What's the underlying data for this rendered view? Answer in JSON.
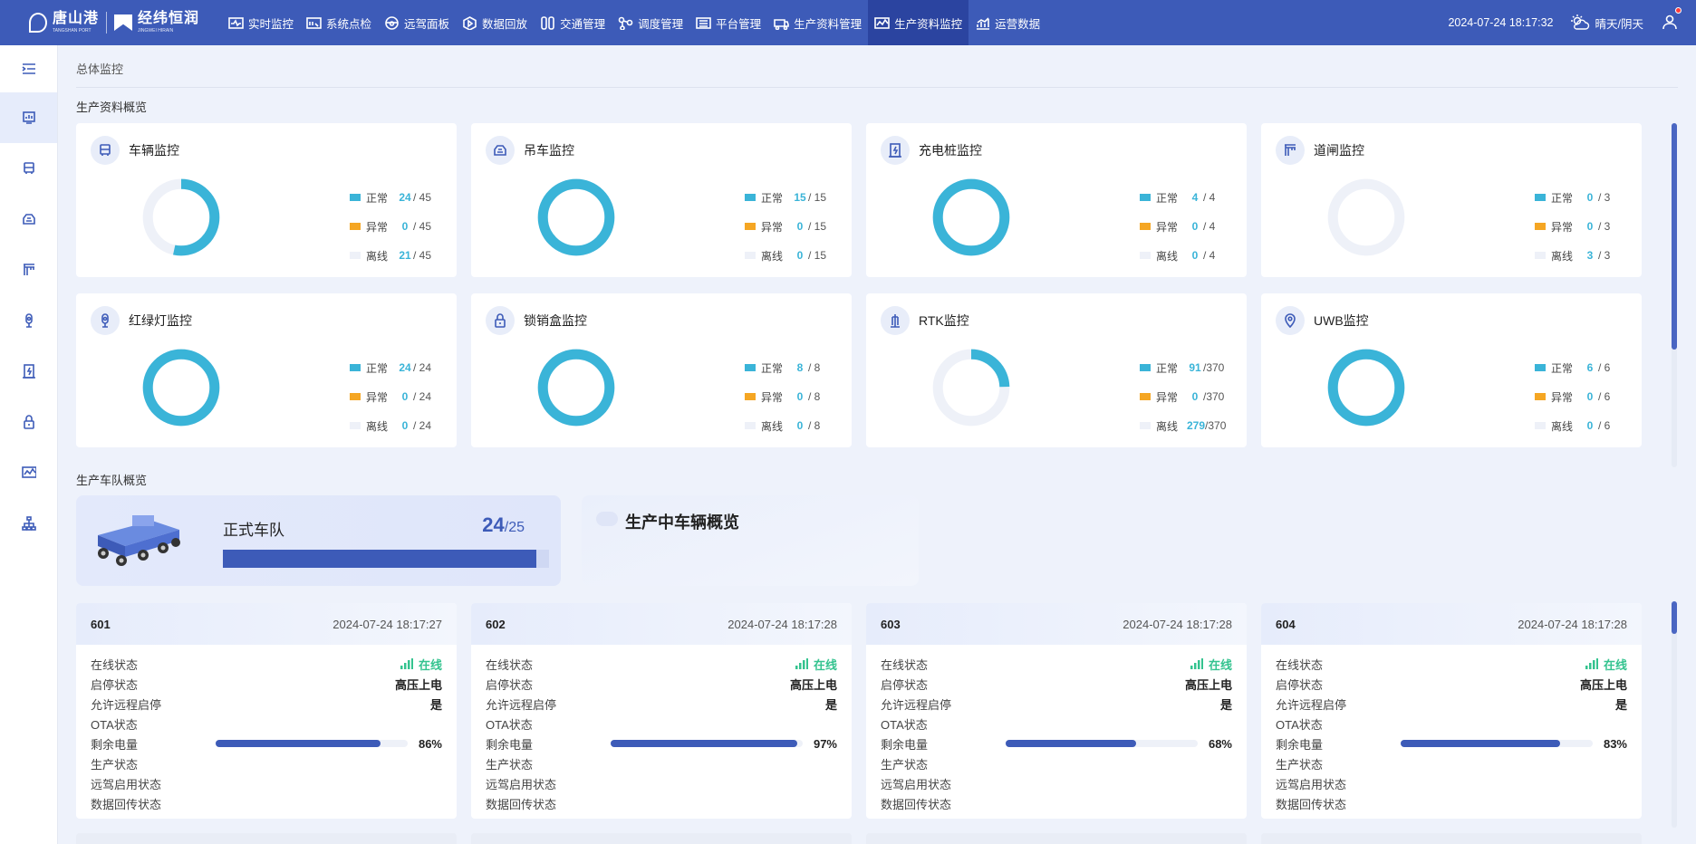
{
  "topbar": {
    "logo1": "唐山港",
    "logo1_sub": "TANGSHAN PORT",
    "logo2": "经纬恒润",
    "logo2_sub": "JINGWEI HIRAIN",
    "nav": [
      {
        "label": "实时监控",
        "icon": "pulse-icon"
      },
      {
        "label": "系统点检",
        "icon": "inspect-icon"
      },
      {
        "label": "远驾面板",
        "icon": "steering-icon"
      },
      {
        "label": "数据回放",
        "icon": "replay-icon"
      },
      {
        "label": "交通管理",
        "icon": "traffic-icon"
      },
      {
        "label": "调度管理",
        "icon": "dispatch-icon"
      },
      {
        "label": "平台管理",
        "icon": "settings-icon"
      },
      {
        "label": "生产资料管理",
        "icon": "truck-icon"
      },
      {
        "label": "生产资料监控",
        "icon": "monitor-icon"
      },
      {
        "label": "运营数据",
        "icon": "chart-icon"
      }
    ],
    "active_index": 8,
    "datetime": "2024-07-24 18:17:32",
    "weather": "晴天/阴天"
  },
  "breadcrumb": "总体监控",
  "section_resources": "生产资料概览",
  "section_fleet": "生产车队概览",
  "legend_labels": {
    "normal": "正常",
    "abnormal": "异常",
    "offline": "离线"
  },
  "monitors": [
    {
      "title": "车辆监控",
      "icon": "vehicle-icon",
      "normal": 24,
      "abnormal": 0,
      "offline": 21,
      "total": 45,
      "t_normal": "/ 45",
      "t_abnormal": "/ 45",
      "t_offline": "/ 45"
    },
    {
      "title": "吊车监控",
      "icon": "crane-icon",
      "normal": 15,
      "abnormal": 0,
      "offline": 0,
      "total": 15,
      "t_normal": "/ 15",
      "t_abnormal": "/ 15",
      "t_offline": "/ 15"
    },
    {
      "title": "充电桩监控",
      "icon": "charger-icon",
      "normal": 4,
      "abnormal": 0,
      "offline": 0,
      "total": 4,
      "t_normal": "/ 4",
      "t_abnormal": "/ 4",
      "t_offline": "/ 4"
    },
    {
      "title": "道闸监控",
      "icon": "gate-icon",
      "normal": 0,
      "abnormal": 0,
      "offline": 3,
      "total": 3,
      "t_normal": "/ 3",
      "t_abnormal": "/ 3",
      "t_offline": "/ 3"
    },
    {
      "title": "红绿灯监控",
      "icon": "traffic-light-icon",
      "normal": 24,
      "abnormal": 0,
      "offline": 0,
      "total": 24,
      "t_normal": "/ 24",
      "t_abnormal": "/ 24",
      "t_offline": "/ 24"
    },
    {
      "title": "锁销盒监控",
      "icon": "lock-icon",
      "normal": 8,
      "abnormal": 0,
      "offline": 0,
      "total": 8,
      "t_normal": "/ 8",
      "t_abnormal": "/ 8",
      "t_offline": "/ 8"
    },
    {
      "title": "RTK监控",
      "icon": "rtk-icon",
      "normal": 91,
      "abnormal": 0,
      "offline": 279,
      "total": 370,
      "t_normal": "/370",
      "t_abnormal": "/370",
      "t_offline": "/370"
    },
    {
      "title": "UWB监控",
      "icon": "location-pin-icon",
      "normal": 6,
      "abnormal": 0,
      "offline": 0,
      "total": 6,
      "t_normal": "/ 6",
      "t_abnormal": "/ 6",
      "t_offline": "/ 6"
    }
  ],
  "colors": {
    "normal": "#3ab4d8",
    "abnormal": "#f5a623",
    "offline": "#eef1f8",
    "primary": "#3d5bb8",
    "online": "#34c38f"
  },
  "fleet": {
    "title": "正式车队",
    "count": "24",
    "total": "/25",
    "ratio": 0.96
  },
  "production": {
    "title": "生产中车辆概览"
  },
  "vehicle_labels": [
    "在线状态",
    "启停状态",
    "允许远程启停",
    "OTA状态",
    "剩余电量",
    "生产状态",
    "远驾启用状态",
    "数据回传状态"
  ],
  "vehicles": [
    {
      "id": "601",
      "time": "2024-07-24 18:17:27",
      "online": "在线",
      "power": "高压上电",
      "remote": "是",
      "battery": 86,
      "battery_text": "86%"
    },
    {
      "id": "602",
      "time": "2024-07-24 18:17:28",
      "online": "在线",
      "power": "高压上电",
      "remote": "是",
      "battery": 97,
      "battery_text": "97%"
    },
    {
      "id": "603",
      "time": "2024-07-24 18:17:28",
      "online": "在线",
      "power": "高压上电",
      "remote": "是",
      "battery": 68,
      "battery_text": "68%"
    },
    {
      "id": "604",
      "time": "2024-07-24 18:17:28",
      "online": "在线",
      "power": "高压上电",
      "remote": "是",
      "battery": 83,
      "battery_text": "83%"
    }
  ],
  "sidebar": [
    {
      "icon": "dashboard-icon",
      "active": true
    },
    {
      "icon": "vehicle-icon"
    },
    {
      "icon": "crane-icon"
    },
    {
      "icon": "gate-icon"
    },
    {
      "icon": "traffic-light-icon"
    },
    {
      "icon": "charger-icon"
    },
    {
      "icon": "lock-icon"
    },
    {
      "icon": "monitor-icon"
    },
    {
      "icon": "network-icon"
    }
  ]
}
